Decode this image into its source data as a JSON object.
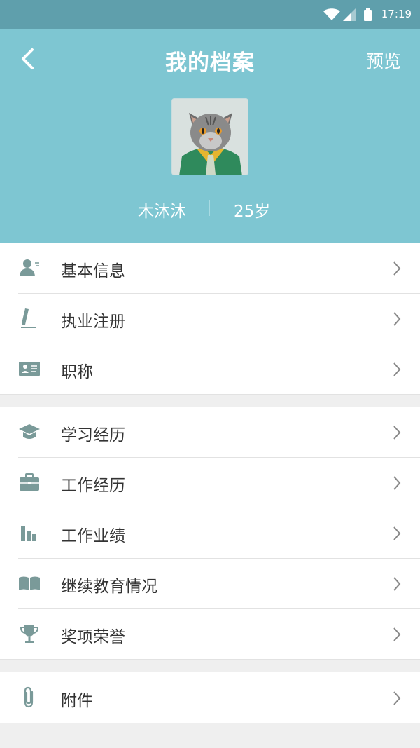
{
  "status_bar": {
    "time": "17:19"
  },
  "header": {
    "title": "我的档案",
    "preview_label": "预览",
    "name": "木沐沐",
    "age": "25岁"
  },
  "menu_groups": [
    [
      {
        "label": "基本信息",
        "icon": "user-info-icon"
      },
      {
        "label": "执业注册",
        "icon": "pencil-icon"
      },
      {
        "label": "职称",
        "icon": "id-card-icon"
      }
    ],
    [
      {
        "label": "学习经历",
        "icon": "graduation-cap-icon"
      },
      {
        "label": "工作经历",
        "icon": "briefcase-icon"
      },
      {
        "label": "工作业绩",
        "icon": "bar-chart-icon"
      },
      {
        "label": "继续教育情况",
        "icon": "open-book-icon"
      },
      {
        "label": "奖项荣誉",
        "icon": "trophy-icon"
      }
    ],
    [
      {
        "label": "附件",
        "icon": "paperclip-icon"
      }
    ]
  ],
  "colors": {
    "header_bg": "#7ec6d2",
    "status_bar_bg": "#5f9fac",
    "icon_color": "#7a9a99"
  }
}
